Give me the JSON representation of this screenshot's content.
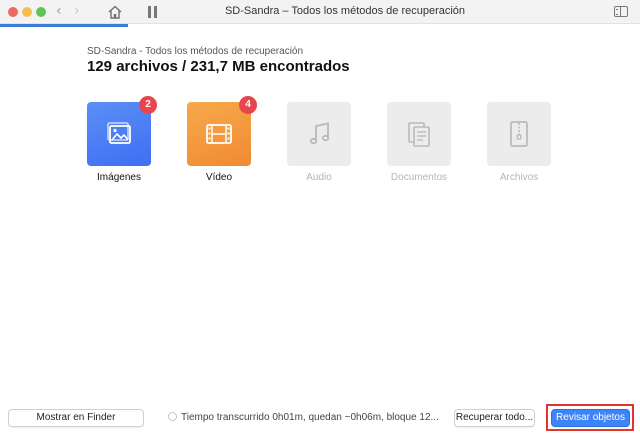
{
  "window": {
    "title": "SD-Sandra – Todos los métodos de recuperación"
  },
  "header": {
    "subtitle": "SD-Sandra - Todos los métodos de recuperación",
    "headline": "129 archivos / 231,7 MB encontrados"
  },
  "categories": [
    {
      "label": "Imágenes",
      "count": "2",
      "icon": "image-icon",
      "color": "#4a7ff5",
      "enabled": true
    },
    {
      "label": "Vídeo",
      "count": "4",
      "icon": "film-icon",
      "color": "#f29a3e",
      "enabled": true
    },
    {
      "label": "Audio",
      "icon": "music-note-icon",
      "enabled": false
    },
    {
      "label": "Documentos",
      "icon": "documents-icon",
      "enabled": false
    },
    {
      "label": "Archivos",
      "icon": "archive-icon",
      "enabled": false
    }
  ],
  "scan_progress": 0.2,
  "footer": {
    "finder_button": "Mostrar en Finder",
    "status": "Tiempo transcurrido 0h01m, quedan ~0h06m, bloque 12...",
    "recover_button": "Recuperar todo...",
    "review_button": "Revisar objetos"
  },
  "colors": {
    "accent": "#3e83f7",
    "highlight": "#e0352b",
    "badge": "#e8464e"
  }
}
